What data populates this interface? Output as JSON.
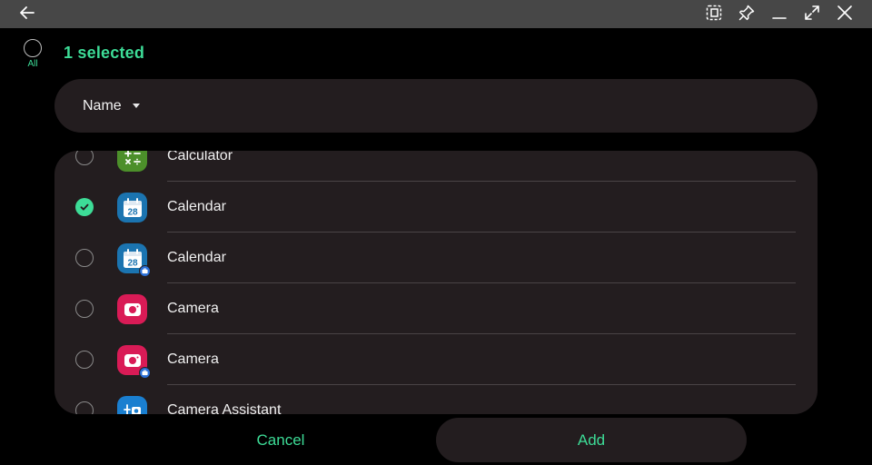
{
  "titlebar": {
    "icons": [
      "back-arrow-icon",
      "snap-window-icon",
      "pin-icon",
      "minimize-icon",
      "maximize-icon",
      "close-icon"
    ]
  },
  "header": {
    "all_label": "All",
    "selected_count": "1 selected"
  },
  "sort": {
    "label": "Name"
  },
  "apps": [
    {
      "name": "Calculator",
      "selected": false,
      "icon": "calculator-icon",
      "color": "#4c8f2a"
    },
    {
      "name": "Calendar",
      "selected": true,
      "icon": "calendar-icon",
      "color": "#1b74b0",
      "day": "28"
    },
    {
      "name": "Calendar",
      "selected": false,
      "icon": "calendar-icon",
      "color": "#1b74b0",
      "day": "28",
      "badge": true
    },
    {
      "name": "Camera",
      "selected": false,
      "icon": "camera-icon",
      "color": "#d91b56"
    },
    {
      "name": "Camera",
      "selected": false,
      "icon": "camera-icon",
      "color": "#d91b56",
      "badge": true
    },
    {
      "name": "Camera Assistant",
      "selected": false,
      "icon": "camera-assistant-icon",
      "color": "#1a7fd0"
    }
  ],
  "actions": {
    "cancel": "Cancel",
    "add": "Add"
  },
  "colors": {
    "accent": "#3ddc97",
    "card": "#231d1f",
    "titlebar": "#474747"
  }
}
